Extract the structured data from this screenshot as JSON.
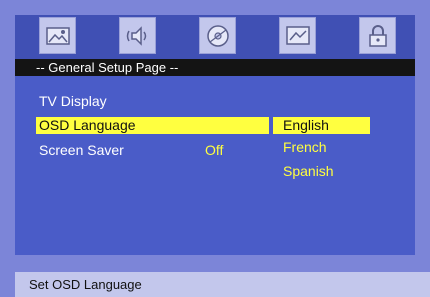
{
  "tabs": [
    {
      "icon": "picture-icon"
    },
    {
      "icon": "speaker-icon"
    },
    {
      "icon": "disc-icon"
    },
    {
      "icon": "image-icon"
    },
    {
      "icon": "lock-icon"
    }
  ],
  "page": {
    "title": "-- General Setup Page --"
  },
  "menu": {
    "items": [
      {
        "label": "TV Display"
      },
      {
        "label": "OSD Language"
      },
      {
        "label": "Screen Saver",
        "value": "Off"
      }
    ],
    "selected": "OSD Language",
    "options": [
      "English",
      "French",
      "Spanish"
    ],
    "selected_option": "English"
  },
  "status": {
    "text": "Set OSD Language"
  },
  "colors": {
    "frame": "#7c85d8",
    "tabbar": "#4050b4",
    "tab": "#c3c7ec",
    "titlebar": "#141414",
    "content": "#4a5cc8",
    "highlight": "#ffff40",
    "text": "#ffffff",
    "value_text": "#ffff40",
    "status_bar": "#c3c7ec"
  }
}
